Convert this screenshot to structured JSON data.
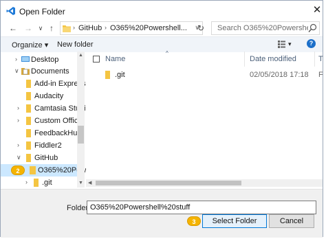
{
  "window": {
    "title": "Open Folder",
    "close_glyph": "✕"
  },
  "nav": {
    "back_glyph": "←",
    "forward_glyph": "→",
    "recent_glyph": "∨",
    "up_glyph": "↑",
    "breadcrumbs": [
      "GitHub",
      "O365%20Powershell..."
    ],
    "crumb_sep": "›",
    "dropdown_glyph": "∨",
    "refresh_glyph": "↻",
    "search_placeholder": "Search O365%20Powershell%2..."
  },
  "toolbar": {
    "organize_label": "Organize ▾",
    "new_folder_label": "New folder",
    "view_dd": "▾",
    "help": "?"
  },
  "tree": {
    "items": [
      {
        "label": "Desktop",
        "chevron": "›",
        "icon": "desktop-icon"
      },
      {
        "label": "Documents",
        "chevron": "∨",
        "icon": "documents-icon"
      },
      {
        "label": "Add-in Express",
        "chevron": "",
        "icon": "folder-icon"
      },
      {
        "label": "Audacity",
        "chevron": "",
        "icon": "folder-icon"
      },
      {
        "label": "Camtasia Studio",
        "chevron": "›",
        "icon": "folder-icon"
      },
      {
        "label": "Custom Office",
        "chevron": "›",
        "icon": "folder-icon"
      },
      {
        "label": "FeedbackHub",
        "chevron": "",
        "icon": "folder-icon"
      },
      {
        "label": "Fiddler2",
        "chevron": "›",
        "icon": "folder-icon"
      },
      {
        "label": "GitHub",
        "chevron": "∨",
        "icon": "folder-icon"
      },
      {
        "label": "O365%20Powe",
        "chevron": "∨",
        "icon": "folder-icon",
        "selected": true
      },
      {
        "label": ".git",
        "chevron": "›",
        "icon": "folder-icon"
      }
    ],
    "callout": "2"
  },
  "list": {
    "columns": [
      "Name",
      "Date modified",
      "T"
    ],
    "sort_glyph": "^",
    "rows": [
      {
        "name": ".git",
        "date": "02/05/2018 17:18",
        "type": "F"
      }
    ]
  },
  "footer": {
    "folder_label": "Folder:",
    "folder_value": "O365%20Powershell%20stuff",
    "select_label": "Select Folder",
    "cancel_label": "Cancel",
    "callout": "3"
  },
  "colors": {
    "accent": "#0078d7",
    "folder": "#f4c542",
    "selection": "#cce8ff",
    "callout": "#f5b400"
  }
}
